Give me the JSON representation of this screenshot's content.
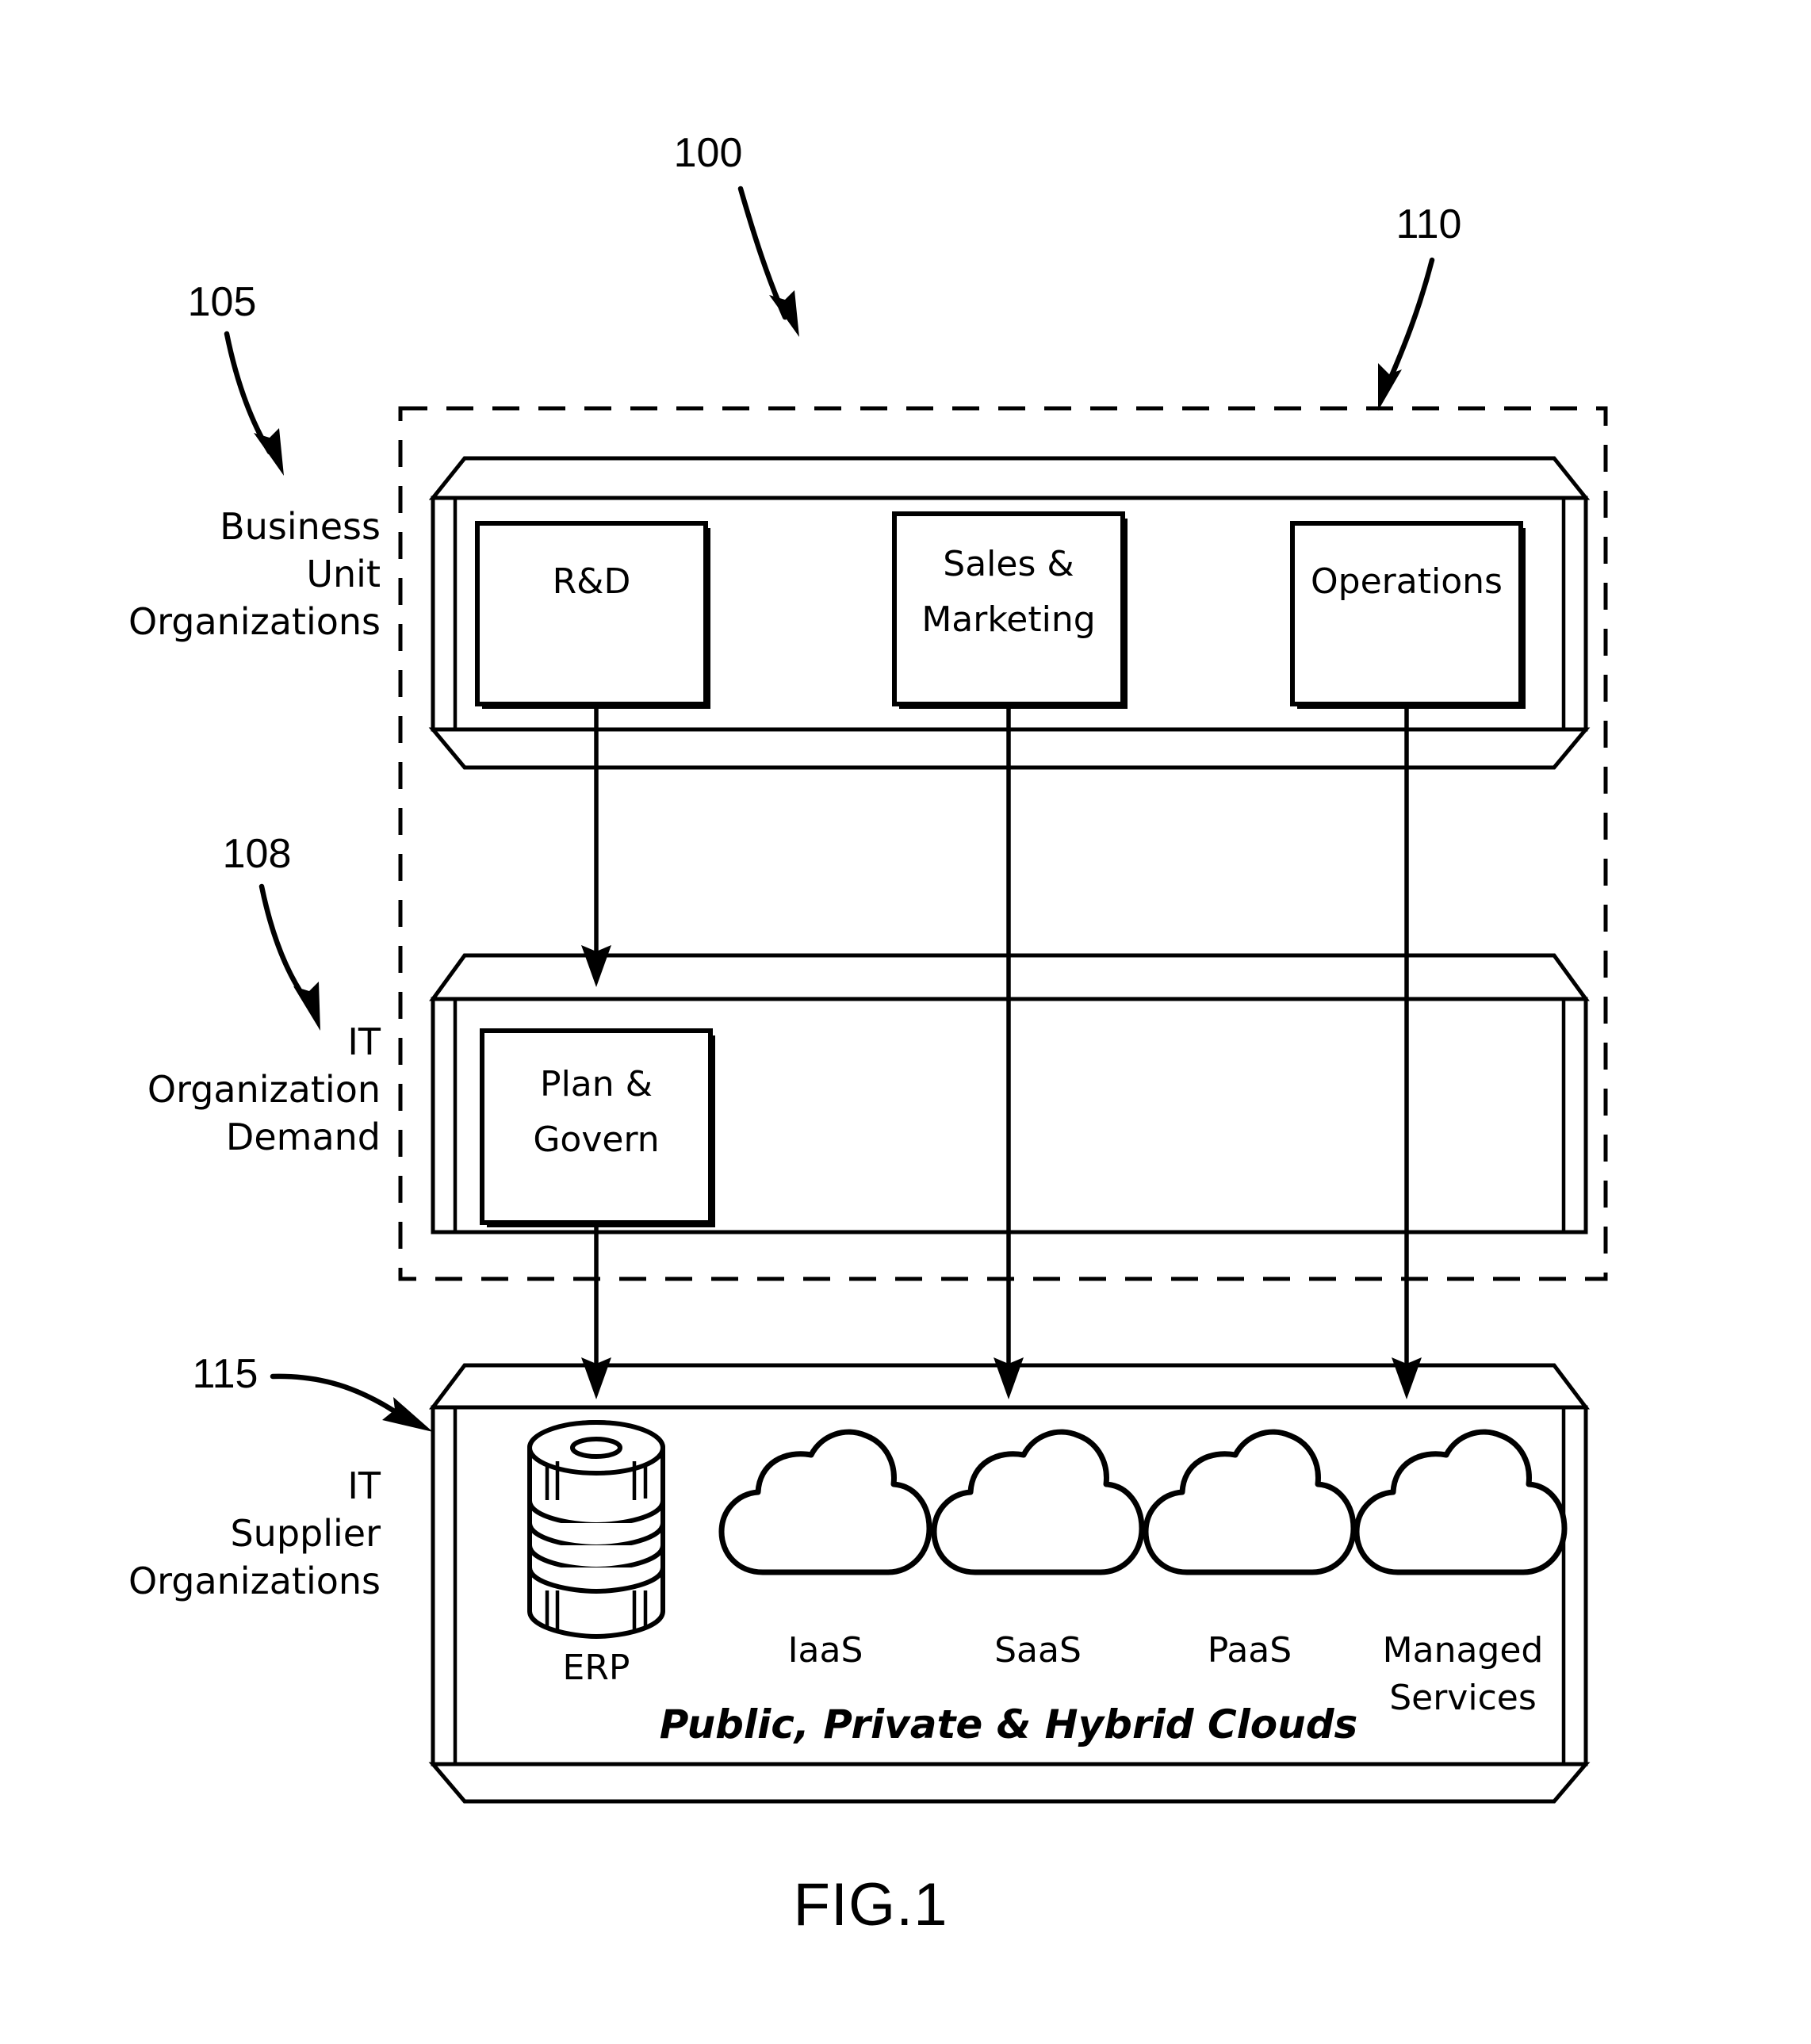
{
  "figure": {
    "caption": "FIG.1",
    "reference_numbers": {
      "system": "100",
      "business_unit": "105",
      "it_demand": "108",
      "enterprise_boundary": "110",
      "supplier": "115"
    }
  },
  "side_labels": {
    "business_unit": [
      "Business",
      "Unit",
      "Organizations"
    ],
    "it_organization": [
      "IT",
      "Organization",
      "Demand"
    ],
    "it_supplier": [
      "IT",
      "Supplier",
      "Organizations"
    ]
  },
  "business_unit_tier": {
    "nodes": [
      {
        "label": "R&D",
        "lines": [
          "R&D"
        ]
      },
      {
        "label": "Sales & Marketing",
        "lines": [
          "Sales  &",
          "Marketing"
        ]
      },
      {
        "label": "Operations",
        "lines": [
          "Operations"
        ]
      }
    ]
  },
  "it_organization_tier": {
    "nodes": [
      {
        "label": "Plan & Govern",
        "lines": [
          "Plan  &",
          "Govern"
        ]
      }
    ]
  },
  "it_supplier_tier": {
    "caption": "Public,  Private  &  Hybrid  Clouds",
    "nodes": [
      {
        "label": "ERP",
        "lines": [
          "ERP"
        ],
        "icon": "database-cylinder-icon"
      },
      {
        "label": "IaaS",
        "lines": [
          "IaaS"
        ],
        "icon": "cloud-icon"
      },
      {
        "label": "SaaS",
        "lines": [
          "SaaS"
        ],
        "icon": "cloud-icon"
      },
      {
        "label": "PaaS",
        "lines": [
          "PaaS"
        ],
        "icon": "cloud-icon"
      },
      {
        "label": "Managed Services",
        "lines": [
          "Managed",
          "Services"
        ],
        "icon": "cloud-icon"
      }
    ]
  },
  "colors": {
    "line": "#000000",
    "background": "#ffffff"
  }
}
